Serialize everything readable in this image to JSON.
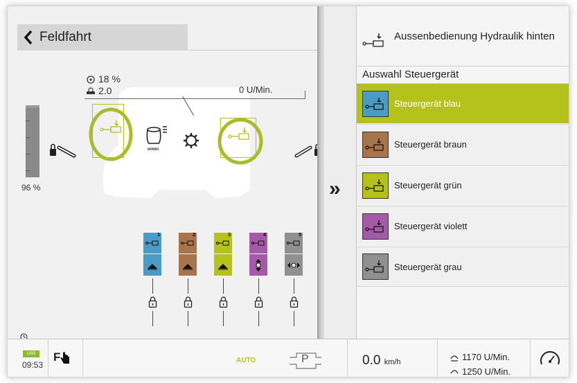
{
  "header": {
    "back_label": "Feldfahrt"
  },
  "left_panel": {
    "stat_percent": "18 %",
    "stat_value": "2.0",
    "rpm_label": "0 U/Min.",
    "pto_unit": "n/min",
    "gauge_percent": "96 %",
    "gauge_level": 0.96,
    "valves": [
      {
        "num": "1",
        "color": "#4a9cc7"
      },
      {
        "num": "2",
        "color": "#a8754a"
      },
      {
        "num": "3",
        "color": "#b5c21b"
      },
      {
        "num": "4",
        "color": "#a45aa8"
      },
      {
        "num": "5",
        "color": "#909090"
      }
    ]
  },
  "right_panel": {
    "title": "Aussenbedienung Hydraulik hinten",
    "section": "Auswahl Steuergerät",
    "options": [
      {
        "label": "Steuergerät blau",
        "color": "#4a9cc7",
        "selected": true
      },
      {
        "label": "Steuergerät braun",
        "color": "#a8754a",
        "selected": false
      },
      {
        "label": "Steuergerät grün",
        "color": "#b5c21b",
        "selected": false
      },
      {
        "label": "Steuergerät violett",
        "color": "#a45aa8",
        "selected": false
      },
      {
        "label": "Steuergerät grau",
        "color": "#909090",
        "selected": false
      }
    ]
  },
  "bottom_bar": {
    "usb_label": "USB",
    "time": "09:53",
    "f_label": "F",
    "auto_label": "AUTO",
    "park_label": "P",
    "speed": "0.0",
    "speed_unit": "km/h",
    "rpm1": "1170 U/Min.",
    "rpm2": "1250 U/Min."
  },
  "colors": {
    "accent": "#b5c21b",
    "highlight_ring": "#a9bd2a"
  }
}
